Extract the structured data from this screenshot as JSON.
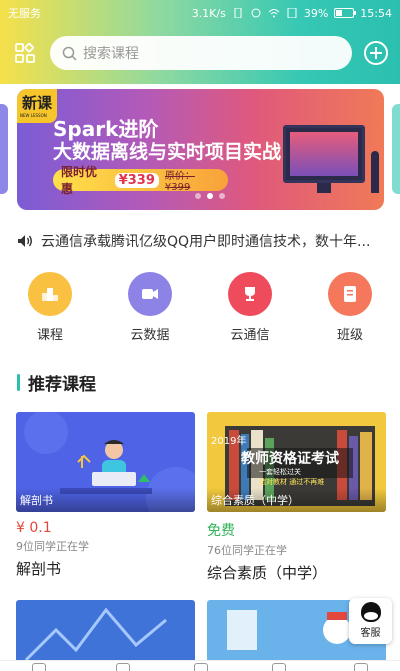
{
  "status": {
    "carrier": "无服务",
    "speed": "3.1K/s",
    "battery": "39%",
    "battery_level": 0.39,
    "time": "15:54"
  },
  "search": {
    "placeholder": "搜索课程"
  },
  "banner": {
    "badge": "新课",
    "badge_sub": "NEW LESSON",
    "title_line1": "Spark进阶",
    "title_line2": "大数据离线与实时项目实战",
    "promo_label": "限时优惠",
    "promo_price": "¥339",
    "original_price": "原价：¥399",
    "slide_count": 3,
    "active_slide": 2
  },
  "notice": {
    "text": "云通信承载腾讯亿级QQ用户即时通信技术，数十年..."
  },
  "categories": [
    {
      "label": "课程",
      "color": "#f9c041",
      "icon": "podium-icon"
    },
    {
      "label": "云数据",
      "color": "#8d83e6",
      "icon": "video-camera-icon"
    },
    {
      "label": "云通信",
      "color": "#ee4b5d",
      "icon": "trophy-icon"
    },
    {
      "label": "班级",
      "color": "#f5775c",
      "icon": "document-icon"
    }
  ],
  "section": {
    "title": "推荐课程"
  },
  "courses": [
    {
      "tag": "解剖书",
      "price": "¥ 0.1",
      "learners": "9位同学正在学",
      "name": "解剖书",
      "thumb_text": "",
      "price_color": "#e4473b"
    },
    {
      "tag": "综合素质（中学）",
      "price": "免费",
      "learners": "76位同学正在学",
      "name": "综合素质（中学）",
      "thumb_text": "教师资格证考试",
      "thumb_year": "2019年",
      "thumb_sub1": "一套轻松过关",
      "thumb_sub2": "选对教材 通过不再难",
      "price_color": "#33b35a"
    }
  ],
  "support": {
    "label": "客服"
  },
  "colors": {
    "accent": "#2bbfb0",
    "header_gradient_start": "#f6e04a",
    "header_gradient_end": "#2bbfb0"
  }
}
